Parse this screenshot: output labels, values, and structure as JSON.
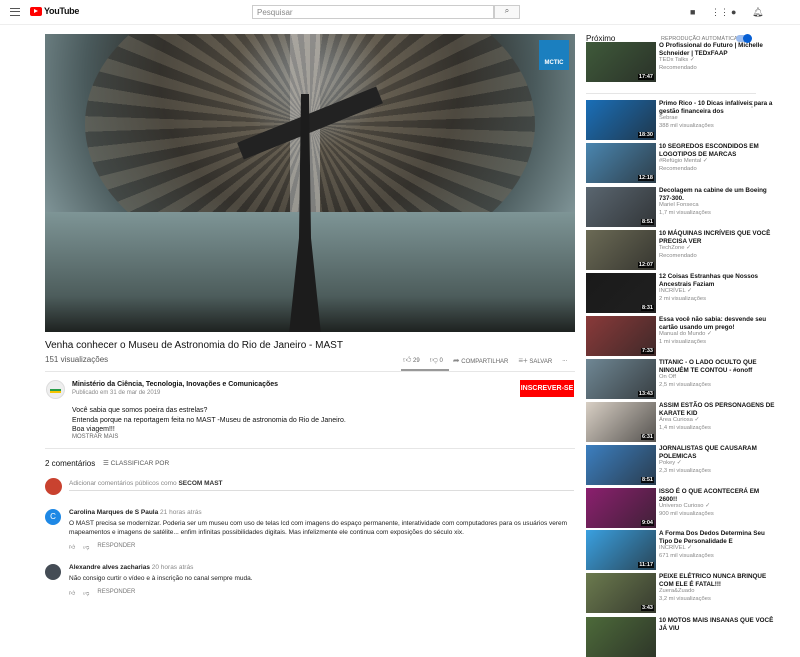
{
  "header": {
    "logo": "YouTube",
    "search_placeholder": "Pesquisar",
    "search_icon": "search-icon"
  },
  "video": {
    "title": "Venha conhecer o Museu de Astronomia do Rio de Janeiro - MAST",
    "views": "151 visualizações",
    "badge": "MCTIC",
    "likes": "29",
    "dislikes": "0",
    "share": "COMPARTILHAR",
    "save": "SALVAR",
    "more": "..."
  },
  "channel": {
    "name": "Ministério da Ciência, Tecnologia, Inovações e Comunicações",
    "published": "Publicado em 31 de mar de 2019",
    "subscribe": "INSCREVER-SE",
    "description": [
      "Você sabia que somos poeira das estrelas?",
      "Entenda porque na reportagem feita no MAST -Museu de astronomia do Rio de Janeiro.",
      "Boa viagem!!!"
    ],
    "show_more": "MOSTRAR MAIS"
  },
  "comments": {
    "count": "2 comentários",
    "sort": "CLASSIFICAR POR",
    "add_prefix": "Adicionar comentários públicos como ",
    "add_user": "SECOM MAST",
    "items": [
      {
        "initial": "C",
        "author": "Carolina Marques de S Paula",
        "time": "21 horas atrás",
        "text": "O MAST precisa se modernizar. Poderia ser um museu com uso de telas lcd com imagens do espaço permanente, interatividade com computadores para os usuários verem mapeamentos e imagens de satélite... enfim infinitas possibilidades digitais. Mas infelizmente ele continua com exposições do século xix.",
        "reply": "RESPONDER",
        "color": "#1e88e5"
      },
      {
        "initial": "",
        "author": "Alexandre alves zacharias",
        "time": "20 horas atrás",
        "text": "Não consigo curtir o vídeo e à inscrição no canal sempre muda.",
        "reply": "RESPONDER",
        "color": "#444c55"
      }
    ]
  },
  "sidebar": {
    "heading": "Próximo",
    "autoplay": "REPRODUÇÃO AUTOMÁTICA",
    "autoplay_on": true,
    "items": [
      {
        "title": "O Profissional do Futuro | Michelle Schneider | TEDxFAAP",
        "channel": "TEDx Talks ✓",
        "meta": "Recomendado",
        "duration": "17:47",
        "color": "#3f5a3a"
      },
      {
        "title": "Primo Rico - 10 Dicas infalíveis para a gestão financeira dos",
        "channel": "Sebrae",
        "meta": "388 mil visualizações",
        "duration": "18:30",
        "color": "#1a6fb8"
      },
      {
        "title": "10 SEGREDOS ESCONDIDOS EM LOGOTIPOS DE MARCAS",
        "channel": "#Refúgio Mental ✓",
        "meta": "Recomendado",
        "duration": "12:18",
        "color": "#4a86b0"
      },
      {
        "title": "Decolagem na cabine de um Boeing 737-300.",
        "channel": "Mariel Fonseca",
        "meta": "1,7 mi visualizações",
        "duration": "8:51",
        "color": "#5a6670"
      },
      {
        "title": "10 MÁQUINAS INCRÍVEIS QUE VOCÊ PRECISA VER",
        "channel": "TechZone ✓",
        "meta": "Recomendado",
        "duration": "12:07",
        "color": "#6b6a55"
      },
      {
        "title": "12 Coisas Estranhas que Nossos Ancestrais Faziam",
        "channel": "INCRÍVEL ✓",
        "meta": "2 mi visualizações",
        "duration": "8:31",
        "color": "#1a1a1a"
      },
      {
        "title": "Essa você não sabia: desvende seu cartão usando um prego!",
        "channel": "Manual do Mundo ✓",
        "meta": "1 mi visualizações",
        "duration": "7:33",
        "color": "#8a3a3a"
      },
      {
        "title": "TITANIC - O LADO OCULTO QUE NINGUÉM TE CONTOU - #onoff",
        "channel": "On Off",
        "meta": "2,5 mi visualizações",
        "duration": "13:43",
        "color": "#6f8794"
      },
      {
        "title": "ASSIM ESTÃO OS PERSONAGENS DE KARATE KID",
        "channel": "Área Curiosa ✓",
        "meta": "1,4 mi visualizações",
        "duration": "6:31",
        "color": "#d8cfc4"
      },
      {
        "title": "JORNALISTAS QUE CAUSARAM POLEMICAS",
        "channel": "Pokey ✓",
        "meta": "2,3 mi visualizações",
        "duration": "8:51",
        "color": "#3c7fc0"
      },
      {
        "title": "ISSO É O QUE ACONTECERÁ EM 2600!!",
        "channel": "Universo Curioso ✓",
        "meta": "900 mil visualizações",
        "duration": "9:04",
        "color": "#8b1f6e"
      },
      {
        "title": "A Forma Dos Dedos Determina Seu Tipo De Personalidade E",
        "channel": "INCRÍVEL ✓",
        "meta": "671 mil visualizações",
        "duration": "11:17",
        "color": "#3aa0e0"
      },
      {
        "title": "PEIXE ELÉTRICO NUNCA BRINQUE COM ELE É FATAL!!!",
        "channel": "Zuera&Zuado",
        "meta": "3,2 mi visualizações",
        "duration": "3:43",
        "color": "#6b7a4e"
      },
      {
        "title": "10 MOTOS MAIS INSANAS QUE VOCÊ JÁ VIU",
        "channel": "",
        "meta": "",
        "duration": "",
        "color": "#4d6a3a"
      }
    ]
  }
}
